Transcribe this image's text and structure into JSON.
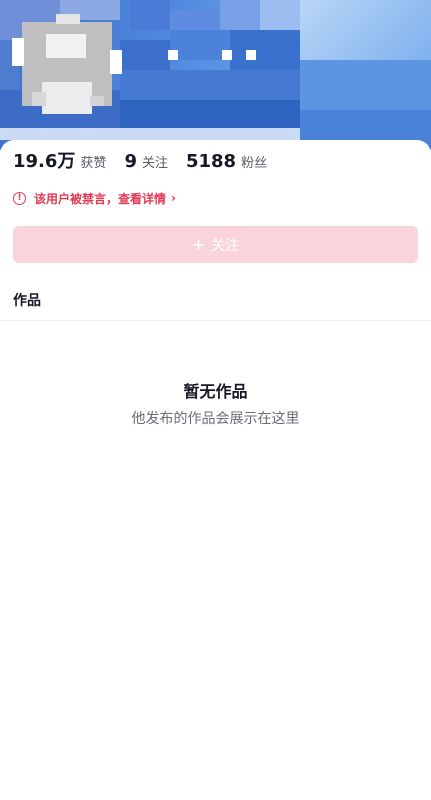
{
  "profile": {
    "stats": [
      {
        "value": "19.6万",
        "label": "获赞"
      },
      {
        "value": "9",
        "label": "关注"
      },
      {
        "value": "5188",
        "label": "粉丝"
      }
    ],
    "ban_notice": "该用户被禁言，查看详情",
    "follow_button": {
      "plus": "+",
      "label": "关注"
    }
  },
  "tabs": {
    "works": "作品"
  },
  "empty_state": {
    "title": "暂无作品",
    "subtitle": "他发布的作品会展示在这里"
  },
  "colors": {
    "accent": "#e03a55",
    "follow_button_disabled": "#f9d5db"
  },
  "icons": {
    "ban": "alert-circle-icon",
    "chevron": "chevron-right-icon"
  }
}
